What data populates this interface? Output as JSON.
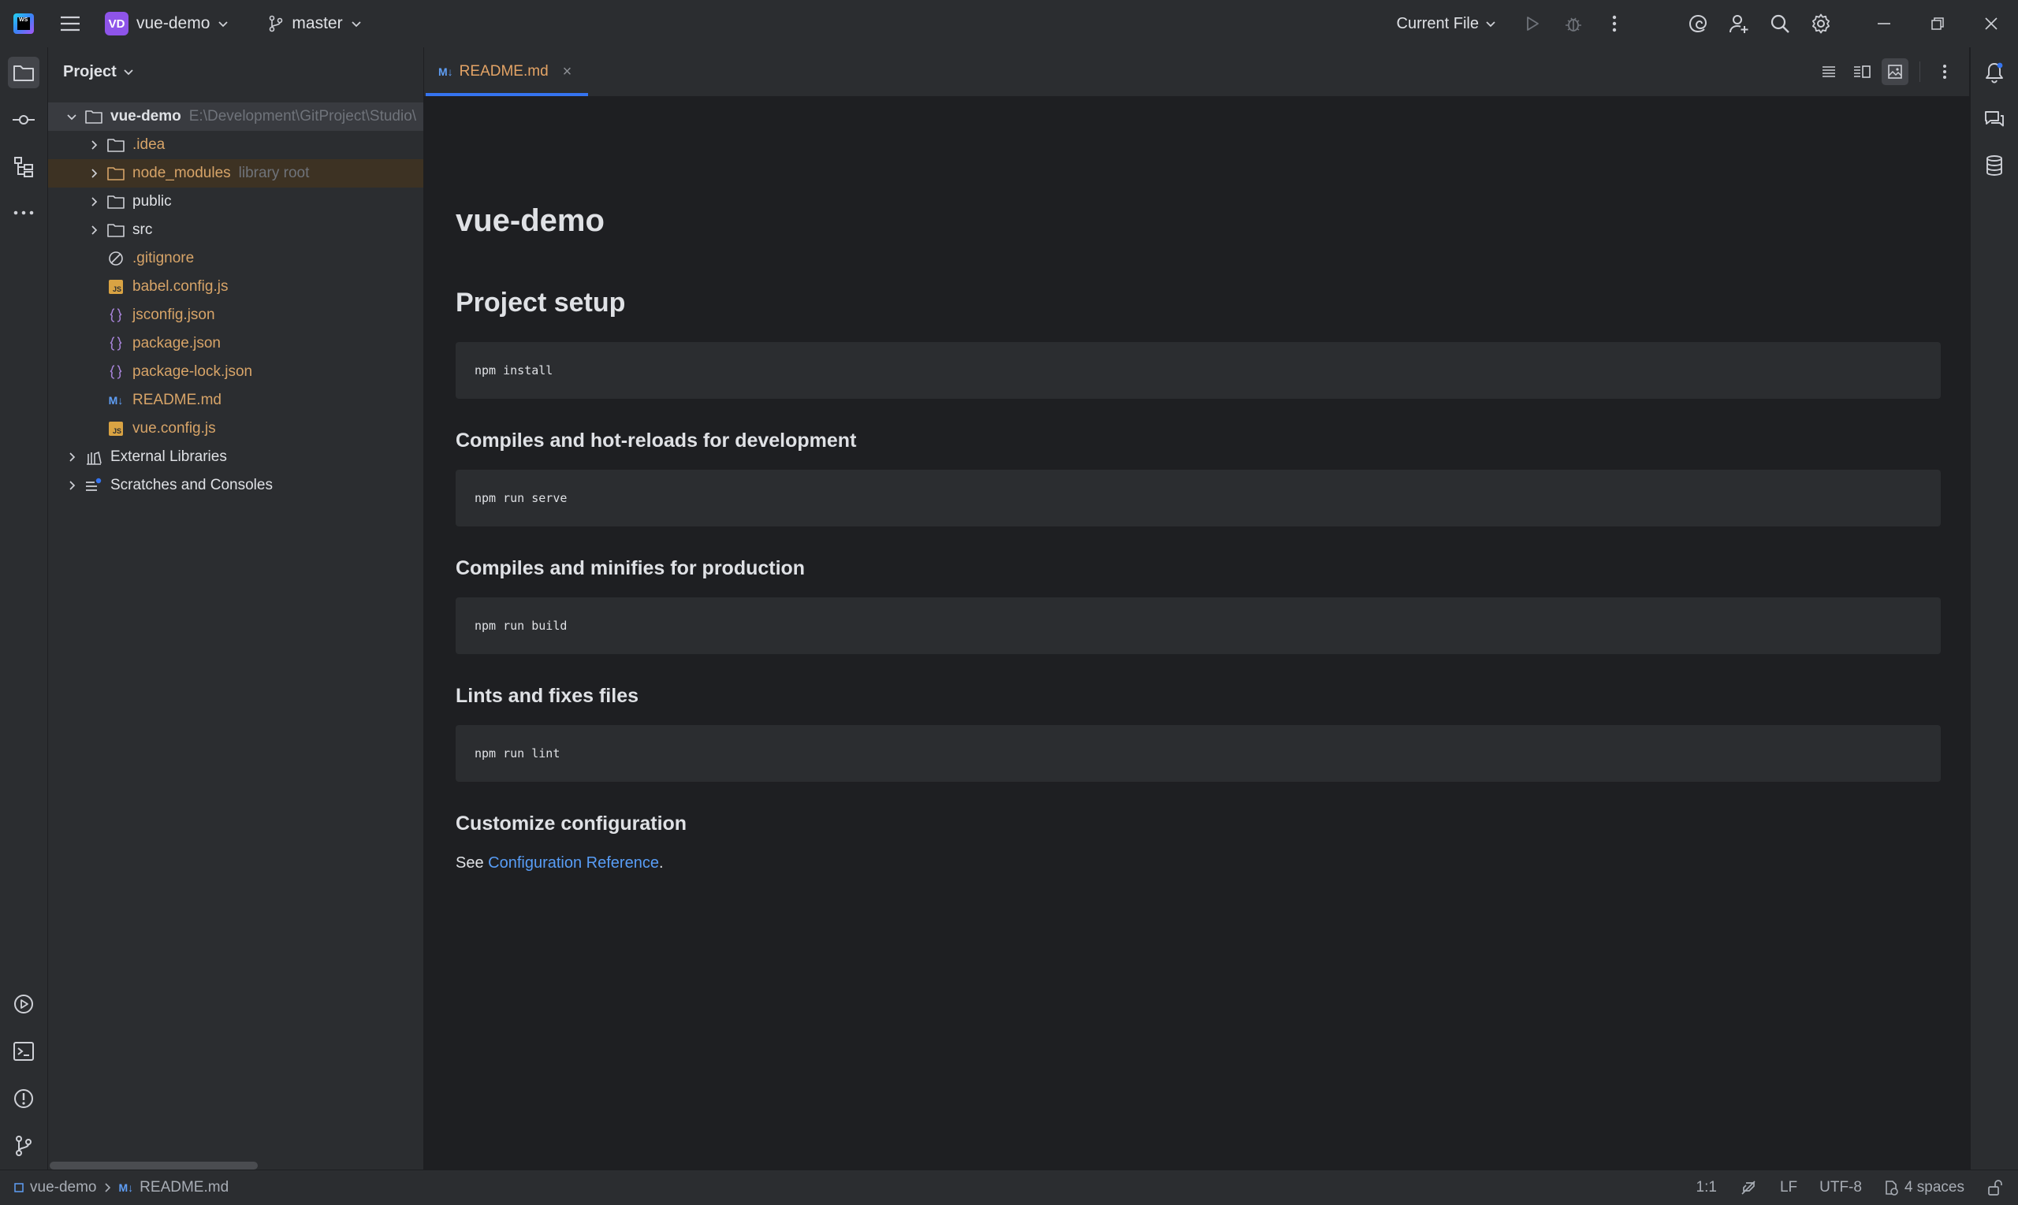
{
  "titlebar": {
    "project_badge": "VD",
    "project_name": "vue-demo",
    "branch": "master",
    "run_config": "Current File"
  },
  "project_panel": {
    "title": "Project",
    "root": {
      "name": "vue-demo",
      "path": "E:\\Development\\GitProject\\Studio\\"
    },
    "items": [
      {
        "name": ".idea",
        "kind": "folder"
      },
      {
        "name": "node_modules",
        "kind": "folder",
        "hint": "library root"
      },
      {
        "name": "public",
        "kind": "folder"
      },
      {
        "name": "src",
        "kind": "folder"
      },
      {
        "name": ".gitignore",
        "kind": "ignore"
      },
      {
        "name": "babel.config.js",
        "kind": "js"
      },
      {
        "name": "jsconfig.json",
        "kind": "json"
      },
      {
        "name": "package.json",
        "kind": "json"
      },
      {
        "name": "package-lock.json",
        "kind": "json"
      },
      {
        "name": "README.md",
        "kind": "md"
      },
      {
        "name": "vue.config.js",
        "kind": "js"
      }
    ],
    "external_libraries": "External Libraries",
    "scratches": "Scratches and Consoles"
  },
  "editor": {
    "tab": {
      "label": "README.md",
      "badge": "M↓",
      "close": "×"
    }
  },
  "readme": {
    "title": "vue-demo",
    "setup_heading": "Project setup",
    "setup_code": "npm install",
    "dev_heading": "Compiles and hot-reloads for development",
    "dev_code": "npm run serve",
    "prod_heading": "Compiles and minifies for production",
    "prod_code": "npm run build",
    "lint_heading": "Lints and fixes files",
    "lint_code": "npm run lint",
    "config_heading": "Customize configuration",
    "config_text_prefix": "See ",
    "config_link": "Configuration Reference",
    "config_text_suffix": "."
  },
  "statusbar": {
    "crumb_project": "vue-demo",
    "crumb_badge": "M↓",
    "crumb_file": "README.md",
    "position": "1:1",
    "line_sep": "LF",
    "encoding": "UTF-8",
    "indent": "4 spaces"
  },
  "colors": {
    "accent": "#3574f0",
    "project_badge": "#8e54e9",
    "modified_file": "#d7a468",
    "link": "#589df6"
  }
}
